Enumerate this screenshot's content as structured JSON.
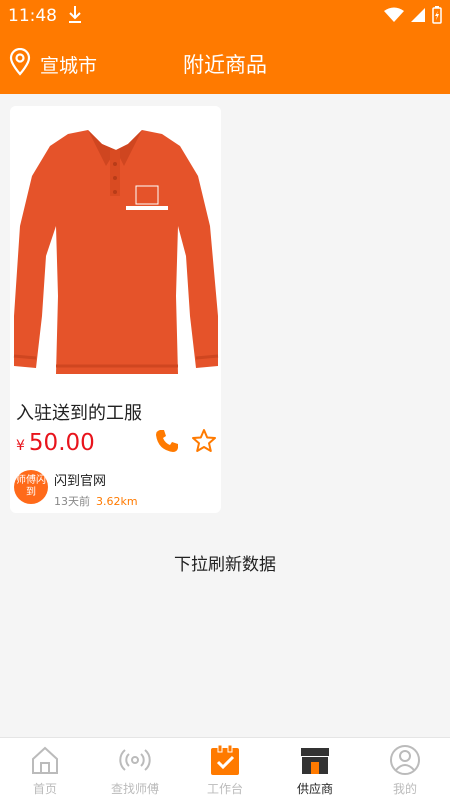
{
  "status": {
    "time": "11:48"
  },
  "header": {
    "city": "宣城市",
    "title": "附近商品"
  },
  "product": {
    "name": "入驻送到的工服",
    "currency": "¥",
    "price": "50.00",
    "shop": "闪到官网",
    "time_ago": "13天前",
    "distance": "3.62km",
    "avatar_text": "师傅闪到"
  },
  "pull_refresh": "下拉刷新数据",
  "tabs": [
    {
      "label": "首页"
    },
    {
      "label": "查找师傅"
    },
    {
      "label": "工作台"
    },
    {
      "label": "供应商"
    },
    {
      "label": "我的"
    }
  ],
  "colors": {
    "accent": "#ff7a00",
    "price": "#e8141c",
    "shirt": "#e5532a"
  }
}
